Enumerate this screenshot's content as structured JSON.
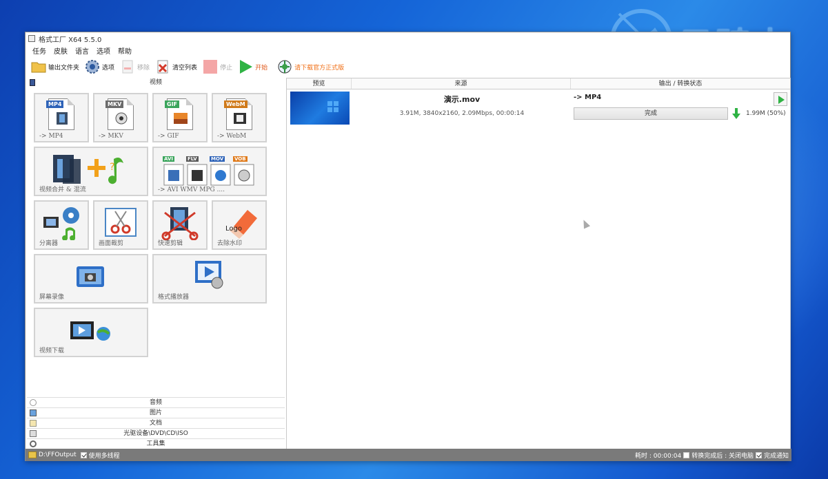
{
  "watermark": {
    "text": "云骑士"
  },
  "window": {
    "title": "格式工厂 X64 5.5.0"
  },
  "menu": [
    "任务",
    "皮肤",
    "语言",
    "选项",
    "帮助"
  ],
  "toolbar": {
    "output_folder": "输出文件夹",
    "options": "选项",
    "remove": "移除",
    "clear_list": "清空列表",
    "stop": "停止",
    "start": "开始",
    "download_official": "请下载官方正式版"
  },
  "left": {
    "video_header": "视频",
    "tiles": {
      "mp4": {
        "badge": "MP4",
        "label": "-> MP4"
      },
      "mkv": {
        "badge": "MKV",
        "label": "-> MKV"
      },
      "gif": {
        "badge": "GIF",
        "label": "-> GIF"
      },
      "webm": {
        "badge": "WebM",
        "label": "-> WebM"
      },
      "merge": {
        "label": "视频合并 & 混流"
      },
      "multi": {
        "badges": [
          "AVI",
          "FLV",
          "MOV",
          "VOB"
        ],
        "label": "-> AVI WMV MPG ...."
      },
      "splitter": {
        "label": "分离器"
      },
      "crop": {
        "label": "画面裁剪"
      },
      "quick_cut": {
        "label": "快速剪辑"
      },
      "remove_watermark": {
        "label": "去除水印",
        "logo_text": "Logo"
      },
      "screen_record": {
        "label": "屏幕录像"
      },
      "player": {
        "label": "格式播放器"
      },
      "video_download": {
        "label": "视频下载"
      }
    },
    "categories": [
      "音频",
      "图片",
      "文档",
      "光驱设备\\DVD\\CD\\ISO",
      "工具集"
    ]
  },
  "list": {
    "columns": [
      "预览",
      "来源",
      "输出 / 转换状态"
    ],
    "rows": [
      {
        "filename": "演示.mov",
        "info": "3.91M, 3840x2160, 2.09Mbps, 00:00:14",
        "target": "-> MP4",
        "status": "完成",
        "output_size": "1.99M  (50%)"
      }
    ]
  },
  "statusline": {
    "output_path": "D:\\FFOutput",
    "multithread": "使用多线程",
    "elapsed": "耗时 : 00:00:04",
    "after_convert": "转换完成后 : 关闭电脑",
    "notify": "完成通知"
  },
  "colors": {
    "start_green": "#2fb344",
    "desktop_blue": "#1565d8",
    "status_gray": "#7a7a7a"
  }
}
